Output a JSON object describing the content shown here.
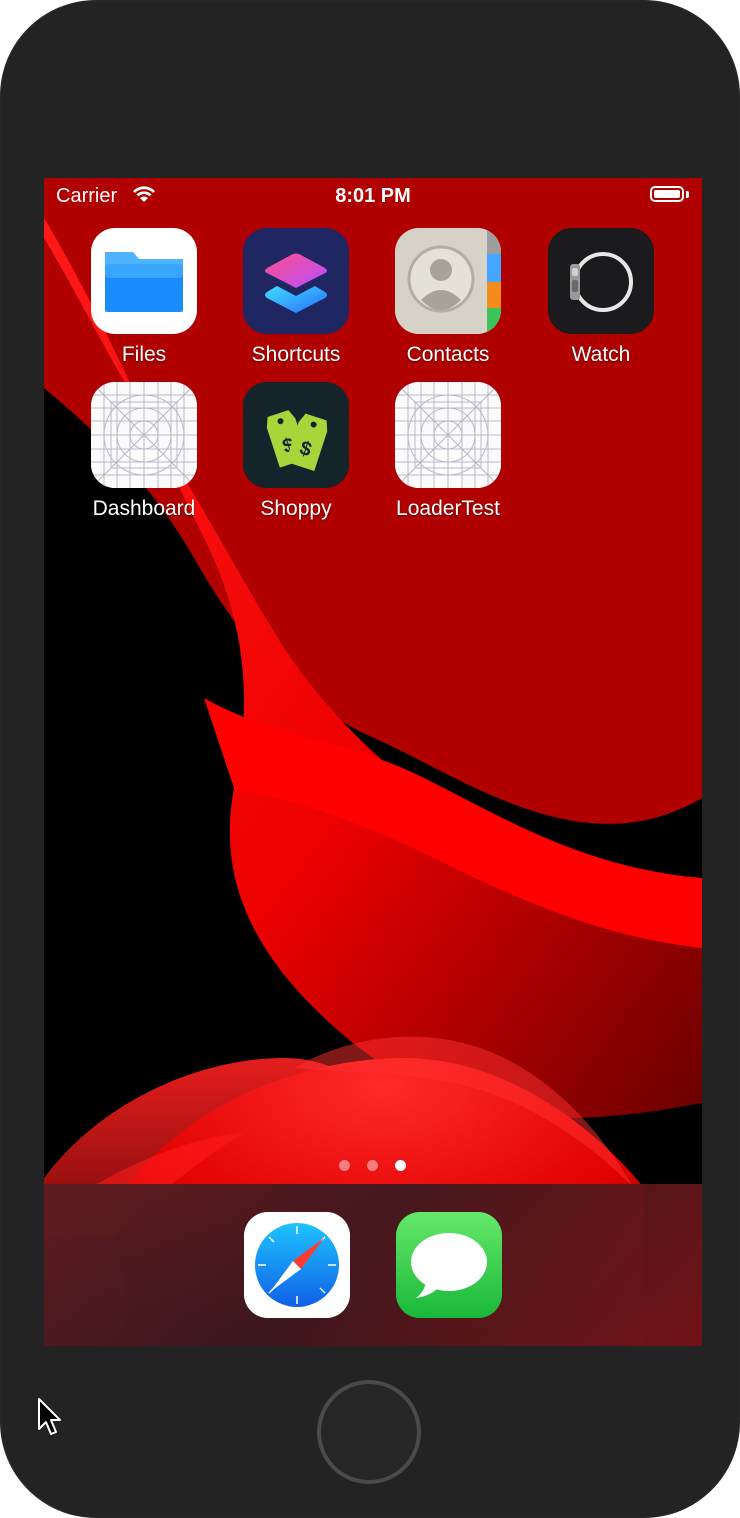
{
  "status_bar": {
    "carrier": "Carrier",
    "time": "8:01 PM",
    "icons": [
      "wifi-icon",
      "battery-icon"
    ]
  },
  "home_screen": {
    "apps": [
      {
        "label": "Files",
        "icon": "files-folder-icon"
      },
      {
        "label": "Shortcuts",
        "icon": "shortcuts-icon"
      },
      {
        "label": "Contacts",
        "icon": "contacts-icon"
      },
      {
        "label": "Watch",
        "icon": "watch-icon"
      },
      {
        "label": "Dashboard",
        "icon": "placeholder-app-icon"
      },
      {
        "label": "Shoppy",
        "icon": "price-tags-icon"
      },
      {
        "label": "LoaderTest",
        "icon": "placeholder-app-icon"
      }
    ],
    "page_count": 3,
    "current_page": 3
  },
  "dock": {
    "apps": [
      {
        "name": "Safari",
        "icon": "safari-compass-icon"
      },
      {
        "name": "Messages",
        "icon": "messages-bubble-icon"
      }
    ]
  },
  "colors": {
    "wallpaper_red": "#ff0000",
    "wallpaper_dark": "#000000",
    "device_body": "#262626",
    "files_blue": "#1a8cff",
    "messages_green": "#2ec94d",
    "shoppy_green": "#a8d63a"
  }
}
